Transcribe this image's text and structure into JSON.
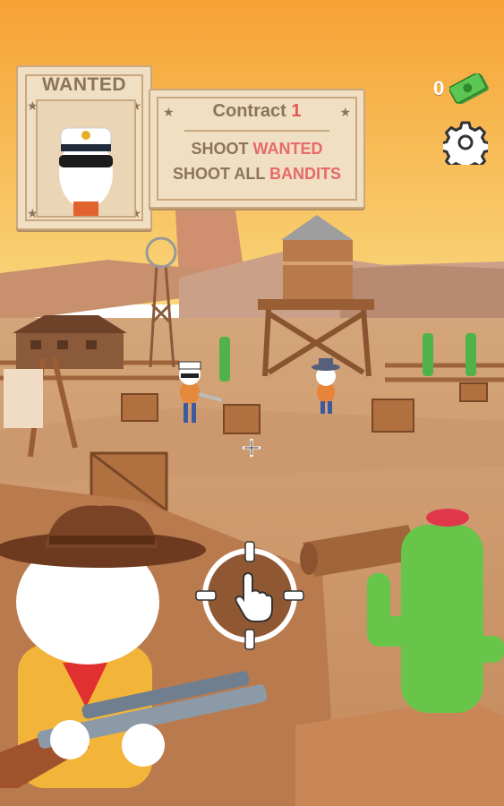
{
  "wanted_poster": {
    "title": "WANTED",
    "portrait_icon": "sailor-bandit-portrait"
  },
  "contract": {
    "title_prefix": "Contract",
    "number": "1",
    "task1_prefix": "SHOOT",
    "task1_target": "WANTED",
    "task2_prefix": "SHOOT ALL",
    "task2_target": "BANDITS"
  },
  "currency": {
    "count": "0",
    "icon": "cash-icon"
  },
  "settings": {
    "icon": "gear-icon"
  },
  "controls": {
    "fire_icon": "tap-hand-icon",
    "crosshair_icon": "aim-crosshair-icon"
  },
  "colors": {
    "sky_top": "#f6a235",
    "sky_bottom": "#f9d67a",
    "highlight": "#e66a6a",
    "card": "#f1dfc3",
    "card_text": "#8c7458"
  }
}
